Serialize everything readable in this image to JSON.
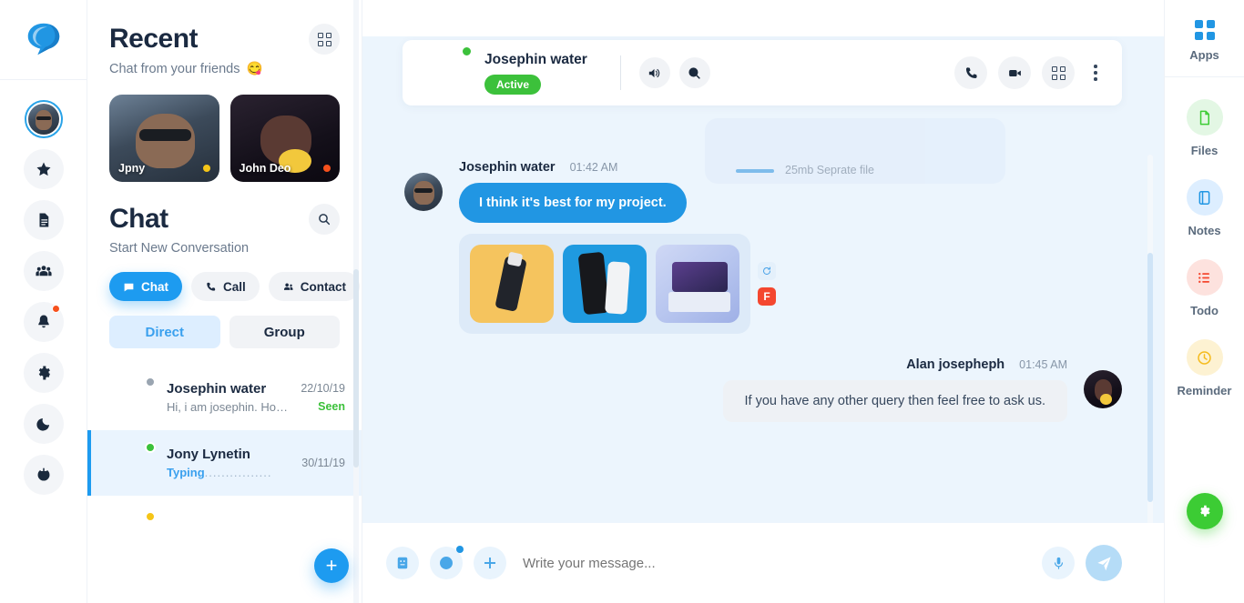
{
  "brand": {
    "logo_icon": "chat-bubble-logo",
    "accent": "#1d9bf0",
    "green": "#3cc13b",
    "red": "#f6511d"
  },
  "left_rail": {
    "items": [
      {
        "icon": "user-avatar",
        "name": "profile-avatar",
        "badge": false
      },
      {
        "icon": "star-icon",
        "name": "favourites",
        "badge": false
      },
      {
        "icon": "file-text-icon",
        "name": "documents",
        "badge": false
      },
      {
        "icon": "users-group-icon",
        "name": "contacts",
        "badge": false
      },
      {
        "icon": "bell-icon",
        "name": "notifications",
        "badge": true
      },
      {
        "icon": "gear-icon",
        "name": "settings",
        "badge": false
      },
      {
        "icon": "moon-icon",
        "name": "dark-mode",
        "badge": false
      },
      {
        "icon": "power-icon",
        "name": "logout",
        "badge": false
      }
    ]
  },
  "sidebar": {
    "recent": {
      "title": "Recent",
      "subtitle": "Chat from your friends",
      "subtitle_emoji": "😋",
      "grid_icon": "grid-icon",
      "cards": [
        {
          "name": "Jpny",
          "status_color": "#f5c518",
          "photo": "ph-man1"
        },
        {
          "name": "John Deo",
          "status_color": "#f6511d",
          "photo": "ph-wom1"
        }
      ]
    },
    "chat": {
      "title": "Chat",
      "subtitle": "Start New Conversation",
      "search_icon": "search-icon",
      "segments": [
        {
          "label": "Chat",
          "icon": "chat-icon",
          "active": true
        },
        {
          "label": "Call",
          "icon": "phone-icon",
          "active": false
        },
        {
          "label": "Contact",
          "icon": "contact-icon",
          "active": false
        }
      ],
      "tabs": [
        {
          "label": "Direct",
          "active": true
        },
        {
          "label": "Group",
          "active": false
        }
      ]
    },
    "conversations": [
      {
        "name": "Josephin water",
        "preview": "Hi, i am josephin. How are ...",
        "date": "22/10/19",
        "status": "Seen",
        "presence": "#9aa5b1",
        "typing": false,
        "selected": false,
        "photo": "ph-wom1"
      },
      {
        "name": "Jony Lynetin",
        "preview": "Typing",
        "preview_dots": "................",
        "date": "30/11/19",
        "status": "",
        "presence": "#3cc13b",
        "typing": true,
        "selected": true,
        "photo": "ph-man1"
      }
    ],
    "add_button": {
      "label": "+",
      "name": "new-chat-fab"
    }
  },
  "chat_header": {
    "name": "Josephin water",
    "status": "Active",
    "presence": "#3cc13b",
    "left_icons": [
      {
        "icon": "speaker-icon",
        "name": "volume-button"
      },
      {
        "icon": "search-icon",
        "name": "search-in-chat-button"
      }
    ],
    "right_icons": [
      {
        "icon": "phone-icon",
        "name": "voice-call-button"
      },
      {
        "icon": "video-icon",
        "name": "video-call-button"
      },
      {
        "icon": "grid-icon",
        "name": "apps-grid-button"
      },
      {
        "icon": "kebab-icon",
        "name": "more-options-button"
      }
    ]
  },
  "messages": {
    "ghost": {
      "text": "25mb Seprate file"
    },
    "items": [
      {
        "name": "Josephin water",
        "time": "01:42 AM",
        "text": "I think it's best for my project.",
        "direction": "in",
        "photo": "ph-man1"
      },
      {
        "direction": "in",
        "type": "gallery",
        "images": [
          "ph-yellow",
          "ph-blue",
          "ph-laptop"
        ],
        "actions": [
          {
            "icon": "refresh-icon",
            "name": "resend-icon"
          },
          {
            "icon": "f-badge",
            "label": "F",
            "name": "flag-badge"
          }
        ]
      },
      {
        "name": "Alan josepheph",
        "time": "01:45 AM",
        "text": "If you have any other query then feel free to ask us.",
        "direction": "out",
        "photo": "ph-wom1"
      }
    ]
  },
  "composer": {
    "placeholder": "Write your message...",
    "left_buttons": [
      {
        "icon": "sticker-icon",
        "name": "sticker-button",
        "dot": false
      },
      {
        "icon": "emoji-icon",
        "name": "emoji-button",
        "dot": true
      },
      {
        "icon": "plus-icon",
        "name": "attach-button",
        "dot": false
      }
    ],
    "mic": {
      "icon": "microphone-icon",
      "name": "voice-record-button"
    },
    "send": {
      "icon": "send-icon",
      "name": "send-button"
    }
  },
  "right_rail": {
    "apps": {
      "label": "Apps",
      "icon": "grid-icon"
    },
    "items": [
      {
        "label": "Files",
        "icon": "file-icon",
        "bg": "#e3f7e4",
        "color": "#3ccc34"
      },
      {
        "label": "Notes",
        "icon": "notebook-icon",
        "bg": "#ddeeff",
        "color": "#2196e3"
      },
      {
        "label": "Todo",
        "icon": "list-icon",
        "bg": "#fde2de",
        "color": "#f4472f"
      },
      {
        "label": "Reminder",
        "icon": "clock-icon",
        "bg": "#fdf2d2",
        "color": "#f5bb1d"
      }
    ],
    "fab": {
      "icon": "gear-icon",
      "name": "settings-fab",
      "color": "#3ccc34"
    }
  }
}
